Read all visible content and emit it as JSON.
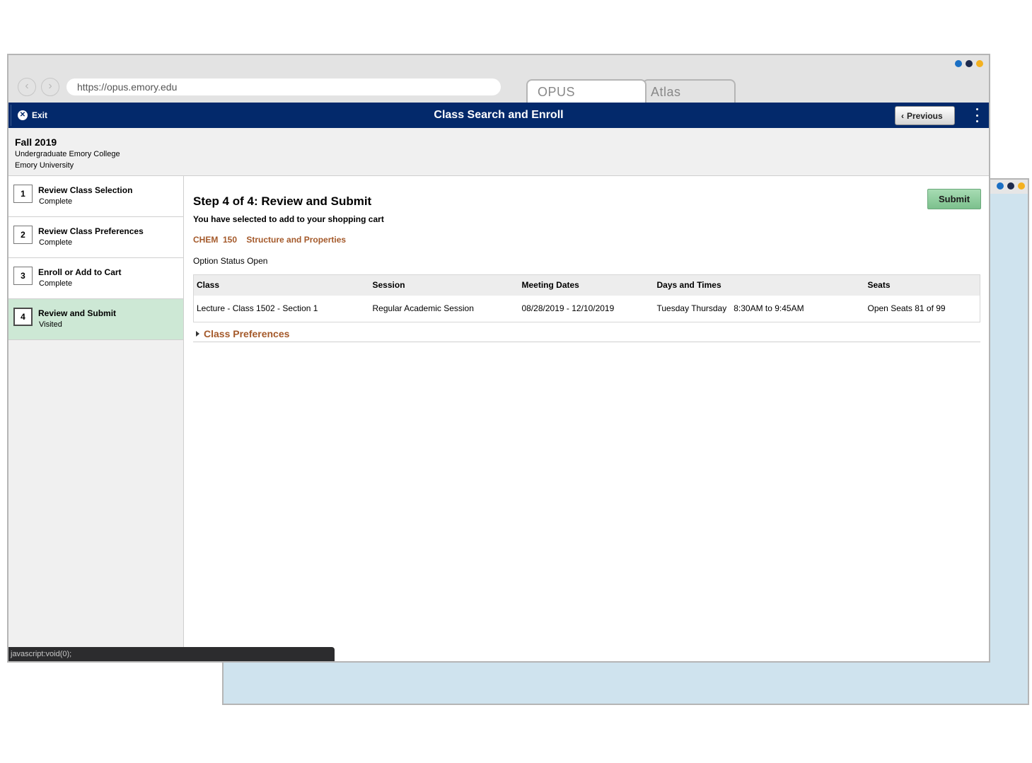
{
  "colors": {
    "dot1": "#1a6fc4",
    "dot2": "#1d2a4d",
    "dot3": "#f4b120",
    "header_bg": "#03296b",
    "accent": "#a4592a"
  },
  "browser": {
    "url": "https://opus.emory.edu",
    "tabs": [
      {
        "label": "OPUS"
      },
      {
        "label": "Atlas"
      }
    ],
    "back_icon": "chevron-left-icon",
    "forward_icon": "chevron-right-icon"
  },
  "header": {
    "exit_label": "Exit",
    "title": "Class Search and Enroll",
    "previous_label": "Previous"
  },
  "term": {
    "title": "Fall 2019",
    "career": "Undergraduate Emory College",
    "institution": "Emory University"
  },
  "steps": [
    {
      "number": "1",
      "label": "Review Class Selection",
      "status": "Complete"
    },
    {
      "number": "2",
      "label": "Review Class Preferences",
      "status": "Complete"
    },
    {
      "number": "3",
      "label": "Enroll or Add to Cart",
      "status": "Complete"
    },
    {
      "number": "4",
      "label": "Review and Submit",
      "status": "Visited"
    }
  ],
  "main": {
    "heading": "Step 4 of 4: Review and Submit",
    "submit_label": "Submit",
    "intro": "You have selected to add to your shopping cart",
    "course_code": "CHEM  150",
    "course_name": "Structure and Properties",
    "option_status_label": "Option Status",
    "option_status_value": "Open",
    "table": {
      "headers": [
        "Class",
        "Session",
        "Meeting Dates",
        "Days and Times",
        "Seats"
      ],
      "row": [
        "Lecture - Class 1502 - Section 1",
        "Regular Academic Session",
        "08/28/2019 - 12/10/2019",
        "Tuesday Thursday   8:30AM to 9:45AM",
        "Open Seats 81 of 99"
      ]
    },
    "class_preferences_label": "Class Preferences"
  },
  "status_bar": "javascript:void(0);"
}
